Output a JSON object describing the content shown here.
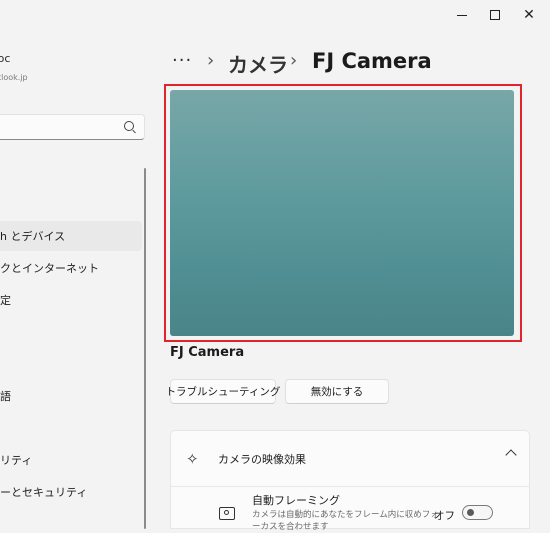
{
  "window_controls": {
    "minimize": "minimize",
    "maximize": "maximize",
    "close": "close"
  },
  "user": {
    "name": "hmoc",
    "email": "@outlook.jp"
  },
  "nav": {
    "items": [
      {
        "label": "h とデバイス",
        "active": true
      },
      {
        "label": "クとインターネット",
        "active": false
      },
      {
        "label": "定",
        "active": false
      },
      {
        "label": "語",
        "active": false
      },
      {
        "label": "リティ",
        "active": false
      },
      {
        "label": "ーとセキュリティ",
        "active": false
      }
    ]
  },
  "breadcrumb": {
    "more": "···",
    "sep": "›",
    "parent": "カメラ",
    "current": "FJ Camera"
  },
  "preview": {
    "outline_color": "#e0252f"
  },
  "device": {
    "name": "FJ Camera",
    "troubleshoot_label": "トラブルシューティング",
    "disable_label": "無効にする"
  },
  "effects": {
    "title": "カメラの映像効果",
    "auto_framing": {
      "title": "自動フレーミング",
      "description": "カメラは自動的にあなたをフレーム内に収めフォーカスを合わせます",
      "toggle_label": "オフ",
      "toggle_on": false
    }
  }
}
